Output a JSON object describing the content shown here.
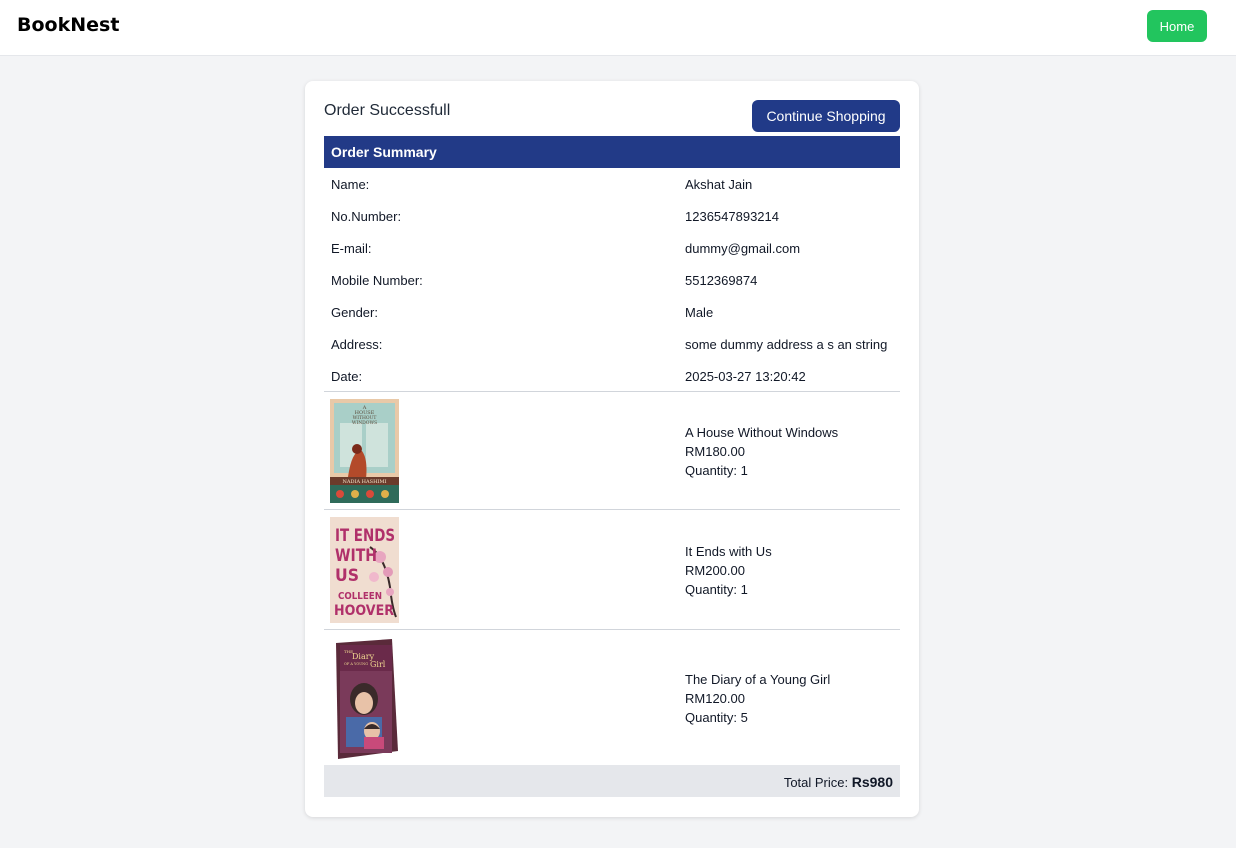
{
  "brand": "BookNest",
  "nav": {
    "home_label": "Home"
  },
  "order": {
    "title": "Order Successfull",
    "continue_label": "Continue Shopping",
    "summary_heading": "Order Summary"
  },
  "details": [
    {
      "label": "Name:",
      "value": "Akshat Jain"
    },
    {
      "label": "No.Number:",
      "value": "1236547893214"
    },
    {
      "label": "E-mail:",
      "value": "dummy@gmail.com"
    },
    {
      "label": "Mobile Number:",
      "value": "5512369874"
    },
    {
      "label": "Gender:",
      "value": "Male"
    },
    {
      "label": "Address:",
      "value": "some dummy address a s an string"
    },
    {
      "label": "Date:",
      "value": "2025-03-27 13:20:42"
    }
  ],
  "items": [
    {
      "title": "A House Without Windows",
      "price": "RM180.00",
      "quantity": "Quantity: 1",
      "cover_lines": [
        "A",
        "HOUSE",
        "WITHOUT",
        "WINDOWS"
      ],
      "cover_author": "NADIA HASHIMI"
    },
    {
      "title": "It Ends with Us",
      "price": "RM200.00",
      "quantity": "Quantity: 1",
      "cover_lines": [
        "IT ENDS",
        "WITH",
        "US"
      ],
      "cover_author_1": "COLLEEN",
      "cover_author_2": "HOOVER"
    },
    {
      "title": "The Diary of a Young Girl",
      "price": "RM120.00",
      "quantity": "Quantity: 5",
      "cover_lines": [
        "THE",
        "Diary",
        "OF A YOUNG",
        "Girl"
      ]
    }
  ],
  "total": {
    "label": "Total Price:",
    "value": "Rs980"
  },
  "colors": {
    "primary": "#223a87",
    "home_button": "#22c55e",
    "background": "#f3f4f6",
    "total_bar": "#e5e7eb"
  }
}
